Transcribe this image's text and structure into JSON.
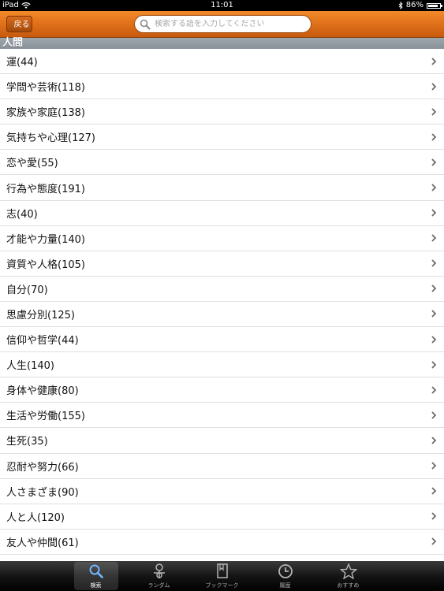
{
  "status": {
    "device": "iPad",
    "time": "11:01",
    "battery": "86%",
    "battery_level": 0.86
  },
  "nav": {
    "back_label": "戻る",
    "search_placeholder": "検索する語を入力してください"
  },
  "section": {
    "title": "人間"
  },
  "items": [
    {
      "label": "運(44)"
    },
    {
      "label": "学問や芸術(118)"
    },
    {
      "label": "家族や家庭(138)"
    },
    {
      "label": "気持ちや心理(127)"
    },
    {
      "label": "恋や愛(55)"
    },
    {
      "label": "行為や態度(191)"
    },
    {
      "label": "志(40)"
    },
    {
      "label": "才能や力量(140)"
    },
    {
      "label": "資質や人格(105)"
    },
    {
      "label": "自分(70)"
    },
    {
      "label": "思慮分別(125)"
    },
    {
      "label": "信仰や哲学(44)"
    },
    {
      "label": "人生(140)"
    },
    {
      "label": "身体や健康(80)"
    },
    {
      "label": "生活や労働(155)"
    },
    {
      "label": "生死(35)"
    },
    {
      "label": "忍耐や努力(66)"
    },
    {
      "label": "人さまざま(90)"
    },
    {
      "label": "人と人(120)"
    },
    {
      "label": "友人や仲間(61)"
    }
  ],
  "tabs": [
    {
      "label": "検索",
      "icon": "search-icon",
      "active": true
    },
    {
      "label": "ランダム",
      "icon": "random-icon",
      "active": false
    },
    {
      "label": "ブックマーク",
      "icon": "bookmark-icon",
      "active": false
    },
    {
      "label": "履歴",
      "icon": "clock-icon",
      "active": false
    },
    {
      "label": "おすすめ",
      "icon": "star-icon",
      "active": false
    }
  ],
  "colors": {
    "nav": "#e0701a",
    "section": "#8a9299",
    "tabbar": "#151515"
  }
}
